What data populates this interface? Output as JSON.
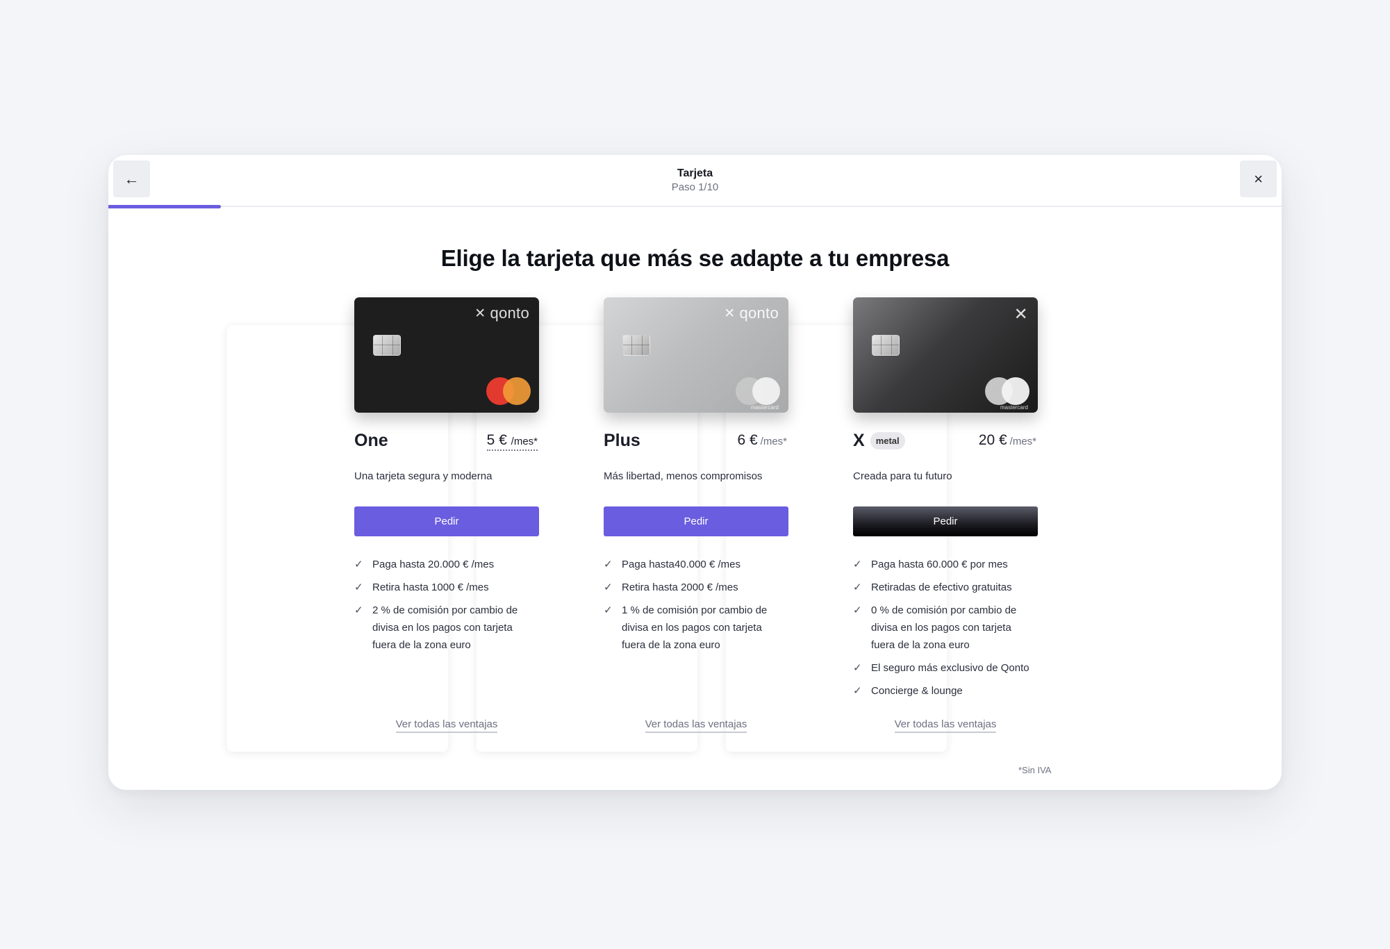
{
  "header": {
    "title": "Tarjeta",
    "step": "Paso 1/10",
    "back_icon": "←",
    "close_icon": "×",
    "progress_fraction": 0.1
  },
  "headline": "Elige la tarjeta que más se adapte a tu empresa",
  "colors": {
    "accent": "#6a5ddf",
    "background": "#f4f5f8"
  },
  "plans": [
    {
      "name": "One",
      "price": "5 €",
      "price_unit": "/mes*",
      "description": "Una tarjeta segura y moderna",
      "button": "Pedir",
      "card_brand": "qonto",
      "features": [
        "Paga hasta 20.000 € /mes",
        "Retira hasta 1000 € /mes",
        "2 % de comisión por cambio de divisa en los pagos con tarjeta fuera de la zona euro"
      ],
      "see_all": "Ver todas las ventajas"
    },
    {
      "name": "Plus",
      "price": "6 €",
      "price_unit": "/mes*",
      "description": "Más libertad, menos compromisos",
      "button": "Pedir",
      "card_brand": "qonto",
      "card_network": "mastercard",
      "features": [
        "Paga hasta40.000 € /mes",
        "Retira hasta 2000 € /mes",
        "1 % de comisión por cambio de divisa en los pagos con tarjeta fuera de la zona euro"
      ],
      "see_all": "Ver todas las ventajas"
    },
    {
      "name": "X",
      "badge": "metal",
      "price": "20 €",
      "price_unit": "/mes*",
      "description": "Creada para tu futuro",
      "button": "Pedir",
      "card_network": "mastercard",
      "features": [
        "Paga hasta 60.000 € por mes",
        "Retiradas de efectivo gratuitas",
        "0 % de comisión por cambio de divisa en los pagos con tarjeta fuera de la zona euro",
        "El seguro más exclusivo de Qonto",
        "Concierge & lounge"
      ],
      "see_all": "Ver todas las ventajas"
    }
  ],
  "tax_note": "*Sin IVA"
}
